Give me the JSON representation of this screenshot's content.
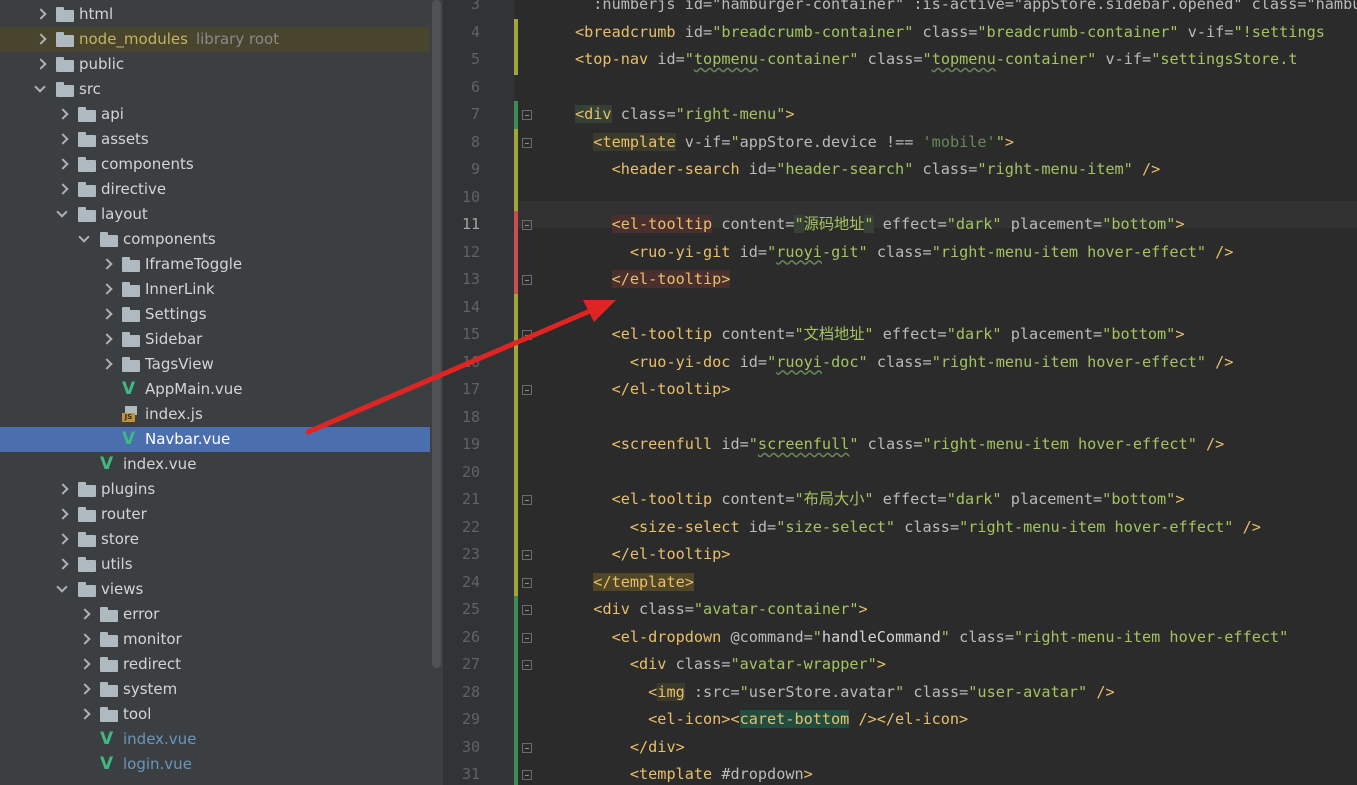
{
  "tree": {
    "items": [
      {
        "label": "html",
        "note": "",
        "depth": 0,
        "chev": "right",
        "icon": "folder",
        "style": ""
      },
      {
        "label": "node_modules",
        "note": "library root",
        "depth": 0,
        "chev": "right",
        "icon": "folder",
        "style": "lib"
      },
      {
        "label": "public",
        "note": "",
        "depth": 0,
        "chev": "right",
        "icon": "folder",
        "style": ""
      },
      {
        "label": "src",
        "note": "",
        "depth": 0,
        "chev": "down",
        "icon": "folder",
        "style": ""
      },
      {
        "label": "api",
        "note": "",
        "depth": 1,
        "chev": "right",
        "icon": "folder",
        "style": ""
      },
      {
        "label": "assets",
        "note": "",
        "depth": 1,
        "chev": "right",
        "icon": "folder",
        "style": ""
      },
      {
        "label": "components",
        "note": "",
        "depth": 1,
        "chev": "right",
        "icon": "folder",
        "style": ""
      },
      {
        "label": "directive",
        "note": "",
        "depth": 1,
        "chev": "right",
        "icon": "folder",
        "style": ""
      },
      {
        "label": "layout",
        "note": "",
        "depth": 1,
        "chev": "down",
        "icon": "folder",
        "style": ""
      },
      {
        "label": "components",
        "note": "",
        "depth": 2,
        "chev": "down",
        "icon": "folder",
        "style": ""
      },
      {
        "label": "IframeToggle",
        "note": "",
        "depth": 3,
        "chev": "right",
        "icon": "folder",
        "style": ""
      },
      {
        "label": "InnerLink",
        "note": "",
        "depth": 3,
        "chev": "right",
        "icon": "folder",
        "style": ""
      },
      {
        "label": "Settings",
        "note": "",
        "depth": 3,
        "chev": "right",
        "icon": "folder",
        "style": ""
      },
      {
        "label": "Sidebar",
        "note": "",
        "depth": 3,
        "chev": "right",
        "icon": "folder",
        "style": ""
      },
      {
        "label": "TagsView",
        "note": "",
        "depth": 3,
        "chev": "right",
        "icon": "folder",
        "style": ""
      },
      {
        "label": "AppMain.vue",
        "note": "",
        "depth": 3,
        "chev": "",
        "icon": "vue",
        "style": ""
      },
      {
        "label": "index.js",
        "note": "",
        "depth": 3,
        "chev": "",
        "icon": "js",
        "style": ""
      },
      {
        "label": "Navbar.vue",
        "note": "",
        "depth": 3,
        "chev": "",
        "icon": "vue",
        "style": "sel"
      },
      {
        "label": "index.vue",
        "note": "",
        "depth": 2,
        "chev": "",
        "icon": "vue",
        "style": ""
      },
      {
        "label": "plugins",
        "note": "",
        "depth": 1,
        "chev": "right",
        "icon": "folder",
        "style": ""
      },
      {
        "label": "router",
        "note": "",
        "depth": 1,
        "chev": "right",
        "icon": "folder",
        "style": ""
      },
      {
        "label": "store",
        "note": "",
        "depth": 1,
        "chev": "right",
        "icon": "folder",
        "style": ""
      },
      {
        "label": "utils",
        "note": "",
        "depth": 1,
        "chev": "right",
        "icon": "folder",
        "style": ""
      },
      {
        "label": "views",
        "note": "",
        "depth": 1,
        "chev": "down",
        "icon": "folder",
        "style": ""
      },
      {
        "label": "error",
        "note": "",
        "depth": 2,
        "chev": "right",
        "icon": "folder",
        "style": ""
      },
      {
        "label": "monitor",
        "note": "",
        "depth": 2,
        "chev": "right",
        "icon": "folder",
        "style": ""
      },
      {
        "label": "redirect",
        "note": "",
        "depth": 2,
        "chev": "right",
        "icon": "folder",
        "style": ""
      },
      {
        "label": "system",
        "note": "",
        "depth": 2,
        "chev": "right",
        "icon": "folder",
        "style": ""
      },
      {
        "label": "tool",
        "note": "",
        "depth": 2,
        "chev": "right",
        "icon": "folder",
        "style": ""
      },
      {
        "label": "index.vue",
        "note": "",
        "depth": 2,
        "chev": "",
        "icon": "vue",
        "style": "vcs"
      },
      {
        "label": "login.vue",
        "note": "",
        "depth": 2,
        "chev": "",
        "icon": "vue",
        "style": "vcs"
      }
    ]
  },
  "editor": {
    "current_line": 11,
    "lines": [
      {
        "n": 3,
        "html": "<span class=\"a\">  :numberjs id=\"hamburger-container\" :is-active=\"appStore.sidebar.opened\" class=\"hambu</span>"
      },
      {
        "n": 4,
        "html": "<span class=\"t\">&lt;breadcrumb</span> <span class=\"a\">id=</span><span class=\"s\">\"breadcrumb-container\"</span> <span class=\"a\">class=</span><span class=\"s\">\"breadcrumb-container\"</span> <span class=\"a\">v-if=</span><span class=\"s\">\"!settings</span>"
      },
      {
        "n": 5,
        "html": "<span class=\"t\">&lt;top-nav</span> <span class=\"a\">id=</span><span class=\"s\">\"<span class=\"ul\">topmenu</span>-container\"</span> <span class=\"a\">class=</span><span class=\"s\">\"<span class=\"ul\">topmenu</span>-container\"</span> <span class=\"a\">v-if=</span><span class=\"s\">\"settingsStore.t</span>"
      },
      {
        "n": 6,
        "html": ""
      },
      {
        "n": 7,
        "html": "<span class=\"t hl\">&lt;div</span> <span class=\"a\">class=</span><span class=\"s\">\"right-menu\"</span><span class=\"t\">&gt;</span>"
      },
      {
        "n": 8,
        "html": "  <span class=\"t hlg\">&lt;template</span> <span class=\"a\">v-if=</span><span class=\"s\">\"</span><span class=\"a\">appStore.device</span> <span class=\"a\">!==</span> <span class=\"s2\">'mobile'</span><span class=\"s\">\"</span><span class=\"t\">&gt;</span>"
      },
      {
        "n": 9,
        "html": "    <span class=\"t\">&lt;header-search</span> <span class=\"a\">id=</span><span class=\"s\">\"header-search\"</span> <span class=\"a\">class=</span><span class=\"s\">\"right-menu-item\"</span> <span class=\"t\">/&gt;</span>"
      },
      {
        "n": 10,
        "html": ""
      },
      {
        "n": 11,
        "html": "    <span class=\"t hlr\">&lt;el-tooltip</span> <span class=\"a\">content=</span><span class=\"s\"><span class=\"hl\">\"</span>源码地址<span class=\"hl\">\"</span></span> <span class=\"a\">effect=</span><span class=\"s\">\"dark\"</span> <span class=\"a\">placement=</span><span class=\"s\">\"bottom\"</span><span class=\"t\">&gt;</span>"
      },
      {
        "n": 12,
        "html": "      <span class=\"t\">&lt;ruo-yi-git</span> <span class=\"a\">id=</span><span class=\"s\">\"<span class=\"ul\">ruoyi</span>-git\"</span> <span class=\"a\">class=</span><span class=\"s\">\"right-menu-item hover-effect\"</span> <span class=\"t\">/&gt;</span>"
      },
      {
        "n": 13,
        "html": "    <span class=\"t hlr\">&lt;/el-tooltip&gt;</span>"
      },
      {
        "n": 14,
        "html": ""
      },
      {
        "n": 15,
        "html": "    <span class=\"t\">&lt;el-tooltip</span> <span class=\"a\">content=</span><span class=\"s\">\"文档地址\"</span> <span class=\"a\">effect=</span><span class=\"s\">\"dark\"</span> <span class=\"a\">placement=</span><span class=\"s\">\"bottom\"</span><span class=\"t\">&gt;</span>"
      },
      {
        "n": 16,
        "html": "      <span class=\"t\">&lt;ruo-yi-doc</span> <span class=\"a\">id=</span><span class=\"s\">\"<span class=\"ul\">ruoyi</span>-doc\"</span> <span class=\"a\">class=</span><span class=\"s\">\"right-menu-item hover-effect\"</span> <span class=\"t\">/&gt;</span>"
      },
      {
        "n": 17,
        "html": "    <span class=\"t\">&lt;/el-tooltip&gt;</span>"
      },
      {
        "n": 18,
        "html": ""
      },
      {
        "n": 19,
        "html": "    <span class=\"t\">&lt;screenfull</span> <span class=\"a\">id=</span><span class=\"s\">\"<span class=\"ul\">screenfull</span>\"</span> <span class=\"a\">class=</span><span class=\"s\">\"right-menu-item hover-effect\"</span> <span class=\"t\">/&gt;</span>"
      },
      {
        "n": 20,
        "html": ""
      },
      {
        "n": 21,
        "html": "    <span class=\"t\">&lt;el-tooltip</span> <span class=\"a\">content=</span><span class=\"s\">\"布局大小\"</span> <span class=\"a\">effect=</span><span class=\"s\">\"dark\"</span> <span class=\"a\">placement=</span><span class=\"s\">\"bottom\"</span><span class=\"t\">&gt;</span>"
      },
      {
        "n": 22,
        "html": "      <span class=\"t\">&lt;size-select</span> <span class=\"a\">id=</span><span class=\"s\">\"size-select\"</span> <span class=\"a\">class=</span><span class=\"s\">\"right-menu-item hover-effect\"</span> <span class=\"t\">/&gt;</span>"
      },
      {
        "n": 23,
        "html": "    <span class=\"t\">&lt;/el-tooltip&gt;</span>"
      },
      {
        "n": 24,
        "html": "  <span class=\"t hly\">&lt;/template&gt;</span>"
      },
      {
        "n": 25,
        "html": "  <span class=\"t\">&lt;div</span> <span class=\"a\">class=</span><span class=\"s\">\"avatar-container\"</span><span class=\"t\">&gt;</span>"
      },
      {
        "n": 26,
        "html": "    <span class=\"t\">&lt;el-dropdown</span> <span class=\"a\">@command=</span><span class=\"s\">\"<span class=\"cn\">handleCommand</span>\"</span> <span class=\"a\">class=</span><span class=\"s\">\"right-menu-item hover-effect\"</span>"
      },
      {
        "n": 27,
        "html": "      <span class=\"t\">&lt;div</span> <span class=\"a\">class=</span><span class=\"s\">\"avatar-wrapper\"</span><span class=\"t\">&gt;</span>"
      },
      {
        "n": 28,
        "html": "        <span class=\"t\">&lt;<span class=\"hlg\">img</span></span> <span class=\"a\">:src=</span><span class=\"s\">\"</span><span class=\"a\">userStore.avatar</span><span class=\"s\">\"</span> <span class=\"a\">class=</span><span class=\"s\">\"user-avatar\"</span> <span class=\"t\">/&gt;</span>"
      },
      {
        "n": 29,
        "html": "        <span class=\"t\">&lt;el-icon&gt;&lt;<span class=\"hlt\">caret-bottom</span> /&gt;&lt;/el-icon&gt;</span>"
      },
      {
        "n": 30,
        "html": "      <span class=\"t\">&lt;/div&gt;</span>"
      },
      {
        "n": 31,
        "html": "      <span class=\"t\">&lt;template</span> <span class=\"a\">#dropdown</span><span class=\"t\">&gt;</span>"
      }
    ]
  },
  "colors": {
    "diff_modified": "#c94f4f",
    "diff_changed": "#a3a43a",
    "diff_added": "#3f8a5a",
    "arrow": "#e02424"
  }
}
